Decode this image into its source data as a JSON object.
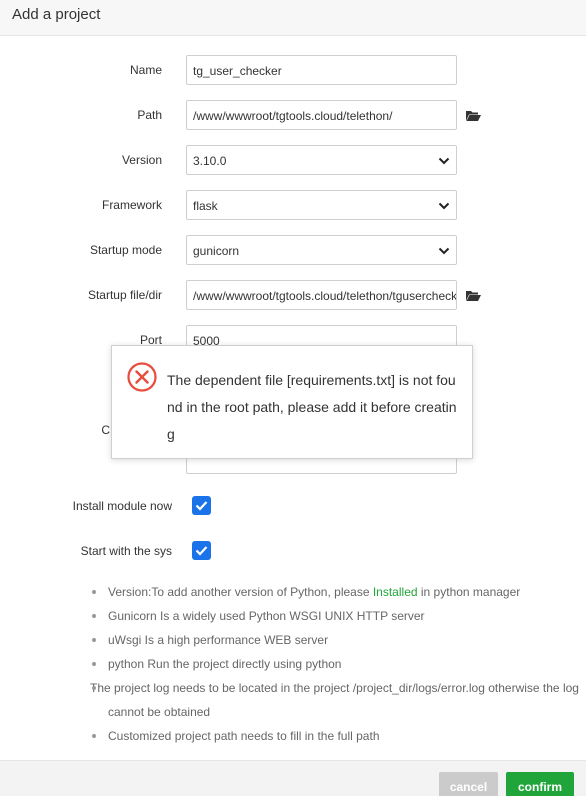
{
  "dialog": {
    "title": "Add a project"
  },
  "form": {
    "name": {
      "label": "Name",
      "value": "tg_user_checker"
    },
    "path": {
      "label": "Path",
      "value": "/www/wwwroot/tgtools.cloud/telethon/"
    },
    "version": {
      "label": "Version",
      "value": "3.10.0"
    },
    "framework": {
      "label": "Framework",
      "value": "flask"
    },
    "startup_mode": {
      "label": "Startup mode",
      "value": "gunicorn"
    },
    "startup_file": {
      "label": "Startup file/dir",
      "value": "/www/wwwroot/tgtools.cloud/telethon/tguserchecker.py"
    },
    "port": {
      "label": "Port",
      "value": "5000"
    },
    "hidden_label_partial": "C",
    "install_module": {
      "label": "Install module now",
      "checked": true
    },
    "start_with_sys": {
      "label": "Start with the sys",
      "checked": true
    }
  },
  "tips": {
    "t1_prefix": "Version:To add another version of Python, please ",
    "t1_link": "Installed",
    "t1_suffix": " in python manager",
    "t2": "Gunicorn Is a widely used Python WSGI UNIX HTTP server",
    "t3": "uWsgi Is a high performance WEB server",
    "t4": "python Run the project directly using python",
    "t5": "The project log needs to be located in the project /project_dir/logs/error.log otherwise the log cannot be obtained",
    "t6": "Customized project path needs to fill in the full path"
  },
  "buttons": {
    "cancel": "cancel",
    "confirm": "confirm"
  },
  "toast": {
    "message": "The dependent file [requirements.txt] is not found in the root path, please add it before creating"
  },
  "colors": {
    "accent": "#1a73e8",
    "success": "#20a53a",
    "error": "#e84c3d"
  }
}
